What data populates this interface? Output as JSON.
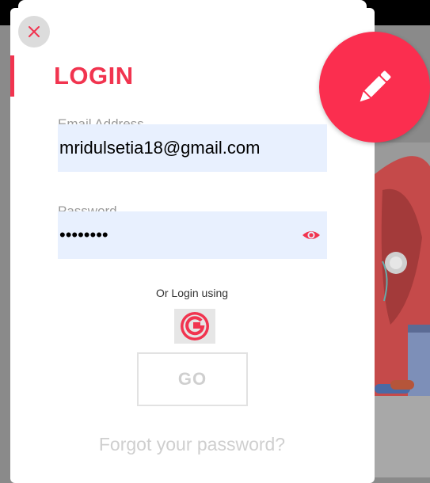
{
  "modal": {
    "title": "LOGIN",
    "email": {
      "label": "Email Address",
      "value": "mridulsetia18@gmail.com"
    },
    "password": {
      "label": "Password",
      "value": "••••••••"
    },
    "or_text": "Or Login using",
    "go_label": "GO",
    "forgot_label": "Forgot your password?"
  },
  "icons": {
    "close": "close-icon",
    "edit": "pencil-icon",
    "eye": "eye-icon",
    "google": "google-icon"
  },
  "colors": {
    "accent": "#f1344f",
    "fab": "#fb2e4f",
    "input_bg": "#e8f0fe"
  }
}
